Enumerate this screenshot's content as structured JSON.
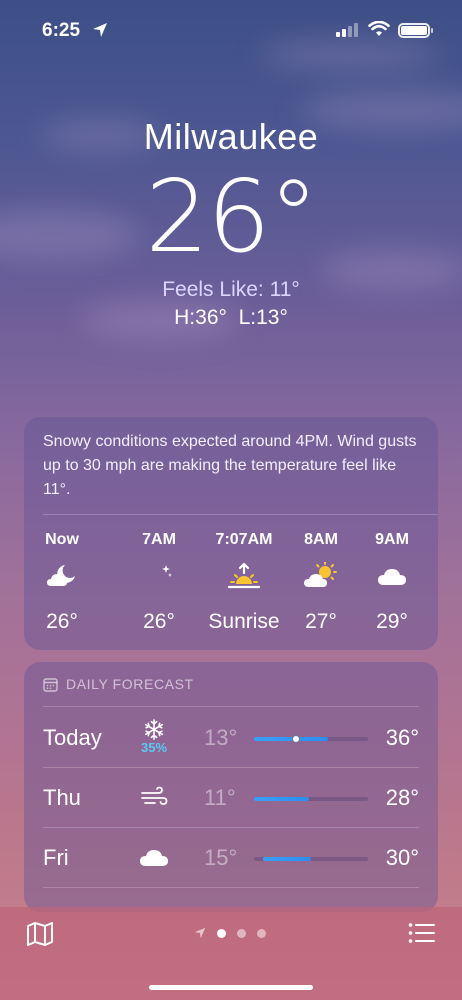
{
  "status": {
    "time": "6:25"
  },
  "header": {
    "city": "Milwaukee",
    "temp": "26°",
    "feels_like": "Feels Like: 11°",
    "high_low": "H:36°  L:13°"
  },
  "hourly": {
    "summary": "Snowy conditions expected around 4PM. Wind gusts up to 30 mph are making the temperature feel like 11°.",
    "items": [
      {
        "label": "Now",
        "icon": "moon-cloud-icon",
        "value": "26°"
      },
      {
        "label": "7AM",
        "icon": "moon-stars-icon",
        "value": "26°"
      },
      {
        "label": "7:07AM",
        "icon": "sunrise-icon",
        "value": "Sunrise"
      },
      {
        "label": "8AM",
        "icon": "sun-cloud-icon",
        "value": "27°"
      },
      {
        "label": "9AM",
        "icon": "cloud-icon",
        "value": "29°"
      }
    ]
  },
  "daily": {
    "header": "DAILY FORECAST",
    "days": [
      {
        "name": "Today",
        "icon": "snowflake-icon",
        "pop": "35%",
        "low": "13°",
        "high": "36°",
        "range_start": 0.0,
        "range_end": 0.65,
        "current": 0.37
      },
      {
        "name": "Thu",
        "icon": "wind-icon",
        "pop": "",
        "low": "11°",
        "high": "28°",
        "range_start": 0.0,
        "range_end": 0.48
      },
      {
        "name": "Fri",
        "icon": "cloud-icon",
        "pop": "",
        "low": "15°",
        "high": "30°",
        "range_start": 0.08,
        "range_end": 0.5
      }
    ]
  },
  "colors": {
    "bar_fill": "#3aa0f5",
    "pop": "#5dc8f5"
  }
}
